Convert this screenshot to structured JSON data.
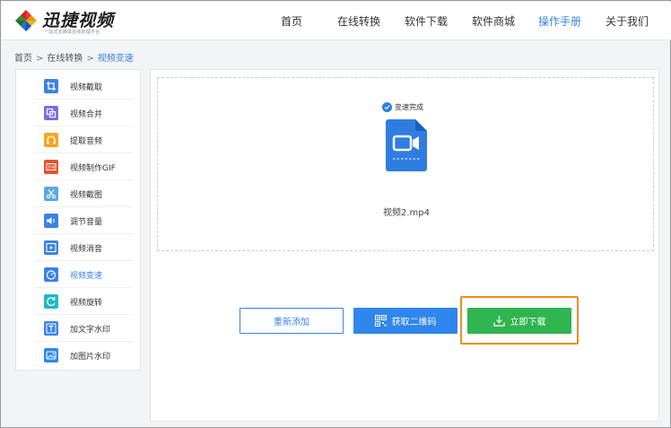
{
  "brand": {
    "name": "迅捷视频",
    "tagline": "一站式多媒体在线处理平台",
    "colors": [
      "#e8372c",
      "#2f8a3a",
      "#1e6fd0",
      "#f5b21c"
    ]
  },
  "nav": {
    "items": [
      {
        "label": "首页"
      },
      {
        "label": "在线转换"
      },
      {
        "label": "软件下载"
      },
      {
        "label": "软件商城"
      },
      {
        "label": "操作手册",
        "active": true
      },
      {
        "label": "关于我们"
      }
    ],
    "active_color": "#3b82e6"
  },
  "breadcrumb": {
    "items": [
      "首页",
      "在线转换",
      "视频变速"
    ],
    "separator": ">"
  },
  "sidebar": {
    "items": [
      {
        "label": "视频截取",
        "icon": "crop-icon",
        "color": "#3b82e6"
      },
      {
        "label": "视频合并",
        "icon": "merge-icon",
        "color": "#7b6be8"
      },
      {
        "label": "提取音频",
        "icon": "headphones-icon",
        "color": "#f5a623"
      },
      {
        "label": "视频制作GIF",
        "icon": "gif-icon",
        "color": "#e8522c"
      },
      {
        "label": "视频截图",
        "icon": "scissors-icon",
        "color": "#5ba8e6"
      },
      {
        "label": "调节音量",
        "icon": "volume-icon",
        "color": "#3b82e6"
      },
      {
        "label": "视频消音",
        "icon": "play-icon",
        "color": "#3b82e6"
      },
      {
        "label": "视频变速",
        "icon": "speedometer-icon",
        "color": "#3b82e6",
        "active": true
      },
      {
        "label": "视频旋转",
        "icon": "rotate-icon",
        "color": "#1fb8c8"
      },
      {
        "label": "加文字水印",
        "icon": "text-icon",
        "color": "#3b82e6"
      },
      {
        "label": "加图片水印",
        "icon": "image-icon",
        "color": "#2f86ec"
      }
    ]
  },
  "result": {
    "status": "变速完成",
    "file_name": "视频2.mp4",
    "file_icon": "video-file-icon"
  },
  "actions": {
    "readd": "重新添加",
    "qrcode": "获取二维码",
    "download": "立即下载"
  },
  "colors": {
    "primary": "#2f86ec",
    "download_green": "#2fb550",
    "highlight_orange": "#f08c1e"
  }
}
